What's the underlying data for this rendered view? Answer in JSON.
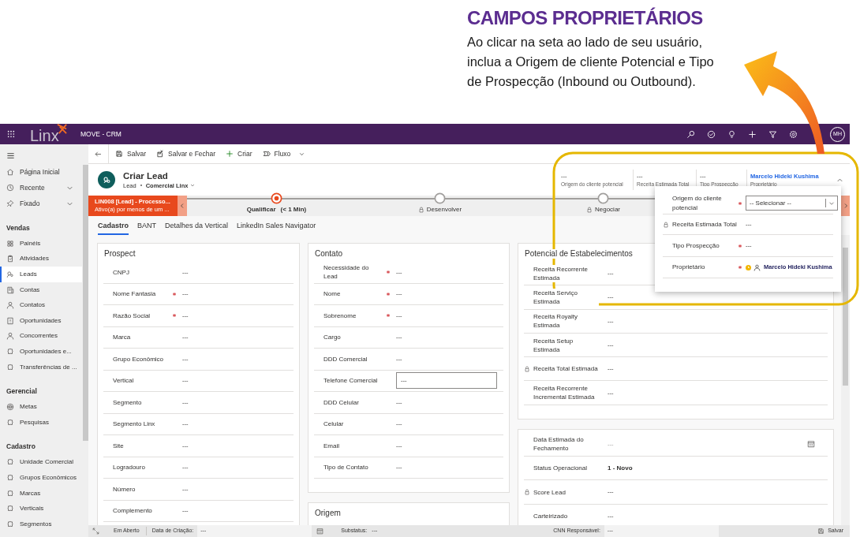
{
  "annotation": {
    "title": "CAMPOS PROPRIETÁRIOS",
    "text": "Ao clicar na seta ao lado de seu usuário, inclua a Origem de cliente Potencial e Tipo de Prospecção (Inbound ou Outbound)."
  },
  "app_bar": {
    "logo": "Linx",
    "app_name": "MOVE - CRM",
    "avatar": "MH"
  },
  "sidebar": {
    "top_items": [
      {
        "label": "Página Inicial",
        "kind": "link"
      },
      {
        "label": "Recente",
        "kind": "group",
        "expanded": false
      },
      {
        "label": "Fixado",
        "kind": "group",
        "expanded": false
      }
    ],
    "sections": [
      {
        "title": "Vendas",
        "items": [
          {
            "label": "Painéis",
            "selected": false
          },
          {
            "label": "Atividades",
            "selected": false
          },
          {
            "label": "Leads",
            "selected": true
          },
          {
            "label": "Contas",
            "selected": false
          },
          {
            "label": "Contatos",
            "selected": false
          },
          {
            "label": "Oportunidades",
            "selected": false
          },
          {
            "label": "Concorrentes",
            "selected": false
          },
          {
            "label": "Oportunidades e...",
            "selected": false
          },
          {
            "label": "Transferências de ...",
            "selected": false
          }
        ]
      },
      {
        "title": "Gerencial",
        "items": [
          {
            "label": "Metas",
            "selected": false
          },
          {
            "label": "Pesquisas",
            "selected": false
          }
        ]
      },
      {
        "title": "Cadastro",
        "items": [
          {
            "label": "Unidade Comercial",
            "selected": false
          },
          {
            "label": "Grupos Econômicos",
            "selected": false
          },
          {
            "label": "Marcas",
            "selected": false
          },
          {
            "label": "Verticais",
            "selected": false
          },
          {
            "label": "Segmentos",
            "selected": false
          }
        ]
      }
    ]
  },
  "command_bar": {
    "buttons": [
      {
        "label": "Salvar",
        "kind": "save"
      },
      {
        "label": "Salvar e Fechar",
        "kind": "save_close"
      },
      {
        "label": "Criar",
        "kind": "new"
      },
      {
        "label": "Fluxo",
        "kind": "flow"
      }
    ]
  },
  "record": {
    "title": "Criar Lead",
    "entity": "Lead",
    "form": "Comercial Linx"
  },
  "header_fields": {
    "expanded": true,
    "fields": [
      {
        "value": "---",
        "label": "Origem do cliente potencial",
        "kind": "text"
      },
      {
        "value": "---",
        "label": "Receita Estimada Total",
        "kind": "text"
      },
      {
        "value": "---",
        "label": "Tipo Prospecção",
        "kind": "text"
      },
      {
        "value": "Marcelo Hideki Kushima",
        "label": "Proprietário",
        "kind": "link"
      }
    ]
  },
  "process": {
    "name": "LIN008 [Lead] - Processo...",
    "status": "Ativo(a) por menos de um ...",
    "stages": [
      {
        "name": "Qualificar",
        "duration": "(< 1 Min)",
        "selected": true,
        "locked": false
      },
      {
        "name": "Desenvolver",
        "selected": false,
        "locked": true
      },
      {
        "name": "Negociar",
        "selected": false,
        "locked": true
      }
    ]
  },
  "tabs": [
    {
      "label": "Cadastro",
      "selected": true
    },
    {
      "label": "BANT",
      "selected": false
    },
    {
      "label": "Detalhes da Vertical",
      "selected": false
    },
    {
      "label": "LinkedIn Sales Navigator",
      "selected": false
    }
  ],
  "columns": [
    [
      {
        "title": "Prospect",
        "fields": [
          {
            "label": "CNPJ",
            "value": "---",
            "required": false,
            "locked": false,
            "kind": "text"
          },
          {
            "label": "Nome Fantasia",
            "value": "---",
            "required": true,
            "locked": false,
            "kind": "text"
          },
          {
            "label": "Razão Social",
            "value": "---",
            "required": true,
            "locked": false,
            "kind": "text"
          },
          {
            "label": "Marca",
            "value": "---",
            "required": false,
            "locked": false,
            "kind": "text"
          },
          {
            "label": "Grupo Econômico",
            "value": "---",
            "required": false,
            "locked": false,
            "kind": "text"
          },
          {
            "label": "Vertical",
            "value": "---",
            "required": false,
            "locked": false,
            "kind": "text"
          },
          {
            "label": "Segmento",
            "value": "---",
            "required": false,
            "locked": false,
            "kind": "text"
          },
          {
            "label": "Segmento Linx",
            "value": "---",
            "required": false,
            "locked": false,
            "kind": "text"
          },
          {
            "label": "Site",
            "value": "---",
            "required": false,
            "locked": false,
            "kind": "text"
          },
          {
            "label": "Logradouro",
            "value": "---",
            "required": false,
            "locked": false,
            "kind": "text"
          },
          {
            "label": "Número",
            "value": "---",
            "required": false,
            "locked": false,
            "kind": "text"
          },
          {
            "label": "Complemento",
            "value": "---",
            "required": false,
            "locked": false,
            "kind": "text"
          }
        ]
      }
    ],
    [
      {
        "title": "Contato",
        "fields": [
          {
            "label": "Necessidade do Lead",
            "value": "---",
            "required": true,
            "locked": false,
            "kind": "text"
          },
          {
            "label": "Nome",
            "value": "---",
            "required": true,
            "locked": false,
            "kind": "text"
          },
          {
            "label": "Sobrenome",
            "value": "---",
            "required": true,
            "locked": false,
            "kind": "text"
          },
          {
            "label": "Cargo",
            "value": "---",
            "required": false,
            "locked": false,
            "kind": "text"
          },
          {
            "label": "DDD Comercial",
            "value": "---",
            "required": false,
            "locked": false,
            "kind": "text"
          },
          {
            "label": "Telefone Comercial",
            "value": "---",
            "required": false,
            "locked": false,
            "kind": "input"
          },
          {
            "label": "DDD Celular",
            "value": "---",
            "required": false,
            "locked": false,
            "kind": "text"
          },
          {
            "label": "Celular",
            "value": "---",
            "required": false,
            "locked": false,
            "kind": "text"
          },
          {
            "label": "Email",
            "value": "---",
            "required": false,
            "locked": false,
            "kind": "text"
          },
          {
            "label": "Tipo de Contato",
            "value": "---",
            "required": false,
            "locked": false,
            "kind": "text"
          }
        ]
      },
      {
        "title": "Origem"
      }
    ],
    [
      {
        "title": "Potencial de Estabelecimentos",
        "fields": [
          {
            "label": "Receita Recorrente Estimada",
            "value": "---",
            "required": false,
            "locked": false,
            "kind": "text"
          },
          {
            "label": "Receita Serviço Estimada",
            "value": "---",
            "required": false,
            "locked": false,
            "kind": "text"
          },
          {
            "label": "Receita Royalty Estimada",
            "value": "---",
            "required": false,
            "locked": false,
            "kind": "text"
          },
          {
            "label": "Receita Setup Estimada",
            "value": "---",
            "required": false,
            "locked": false,
            "kind": "text"
          },
          {
            "label": "Receita Total Estimada",
            "value": "---",
            "required": false,
            "locked": true,
            "kind": "text"
          },
          {
            "label": "Receita Recorrente Incremental Estimada",
            "value": "---",
            "required": false,
            "locked": false,
            "kind": "text"
          }
        ]
      },
      {
        "fields": [
          {
            "label": "Data Estimada do Fechamento",
            "placeholder": "---",
            "required": false,
            "locked": false,
            "kind": "date"
          },
          {
            "label": "Status Operacional",
            "value": "1 - Novo",
            "required": false,
            "locked": false,
            "kind": "strong"
          },
          {
            "label": "Score Lead",
            "value": "---",
            "required": false,
            "locked": true,
            "kind": "text"
          },
          {
            "label": "Carteirizado",
            "value": "---",
            "required": false,
            "locked": false,
            "kind": "text"
          }
        ]
      }
    ]
  ],
  "flyout": {
    "fields": [
      {
        "label": "Origem do cliente potencial",
        "value": "-- Selecionar --",
        "required": true,
        "locked": false,
        "kind": "select"
      },
      {
        "label": "Receita Estimada Total",
        "value": "---",
        "required": false,
        "locked": true,
        "kind": "text"
      },
      {
        "label": "Tipo Prospecção",
        "value": "---",
        "required": true,
        "locked": false,
        "kind": "text"
      },
      {
        "label": "Proprietário",
        "value": "Marcelo Hideki Kushima",
        "required": true,
        "locked": false,
        "kind": "user"
      }
    ]
  },
  "status_bar": {
    "status": "Em Aberto",
    "fields": [
      {
        "label": "Data de Criação:",
        "value": "---"
      },
      {
        "label": "Substatus:",
        "value": "---"
      },
      {
        "label": "CNN Responsável:",
        "value": "---"
      }
    ],
    "save": "Salvar"
  }
}
